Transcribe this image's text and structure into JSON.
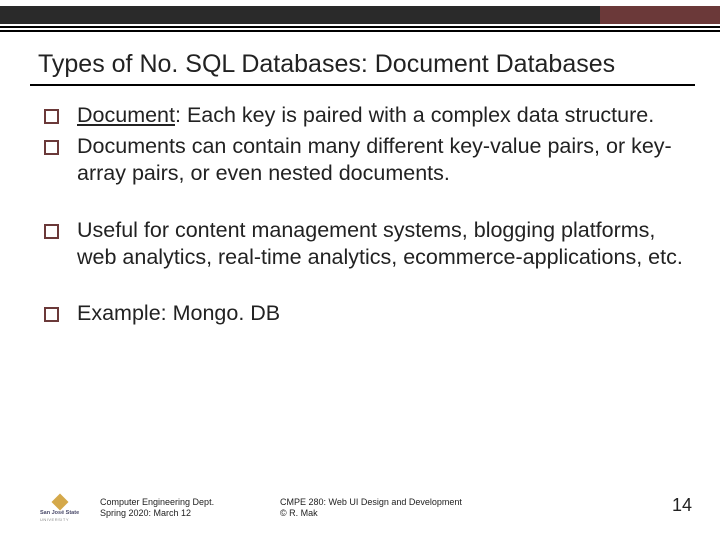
{
  "title": "Types of No. SQL Databases: Document Databases",
  "bullets": [
    {
      "underlined": "Document",
      "rest": ": Each key is paired with a complex data structure."
    },
    {
      "text": "Documents can contain many different key-value pairs, or key-array pairs, or even nested documents."
    },
    {
      "text": "Useful for content management systems, blogging platforms, web analytics, real-time analytics, ecommerce-applications, etc."
    },
    {
      "text": "Example: Mongo. DB"
    }
  ],
  "footer": {
    "dept1": "Computer Engineering Dept.",
    "dept2": "Spring 2020: March 12",
    "course1": "CMPE 280: Web UI Design and Development",
    "course2": "© R. Mak",
    "logo_name": "San José State",
    "logo_sub": "UNIVERSITY"
  },
  "page_number": "14"
}
